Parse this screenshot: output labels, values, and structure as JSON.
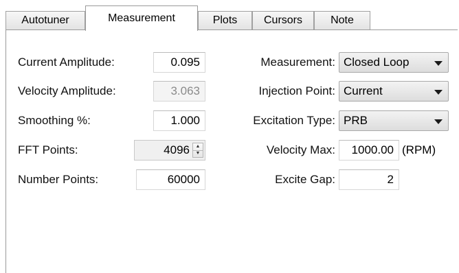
{
  "tabs": [
    {
      "label": "Autotuner"
    },
    {
      "label": "Measurement"
    },
    {
      "label": "Plots"
    },
    {
      "label": "Cursors"
    },
    {
      "label": "Note"
    }
  ],
  "active_tab": "Measurement",
  "left": {
    "current_amplitude": {
      "label": "Current Amplitude:",
      "value": "0.095"
    },
    "velocity_amplitude": {
      "label": "Velocity Amplitude:",
      "value": "3.063"
    },
    "smoothing": {
      "label": "Smoothing %:",
      "value": "1.000"
    },
    "fft_points": {
      "label": "FFT Points:",
      "value": "4096"
    },
    "number_points": {
      "label": "Number Points:",
      "value": "60000"
    }
  },
  "right": {
    "measurement": {
      "label": "Measurement:",
      "value": "Closed Loop"
    },
    "injection_point": {
      "label": "Injection Point:",
      "value": "Current"
    },
    "excitation_type": {
      "label": "Excitation Type:",
      "value": "PRB"
    },
    "velocity_max": {
      "label": "Velocity Max:",
      "value": "1000.00",
      "unit": "(RPM)"
    },
    "excite_gap": {
      "label": "Excite Gap:",
      "value": "2"
    }
  }
}
